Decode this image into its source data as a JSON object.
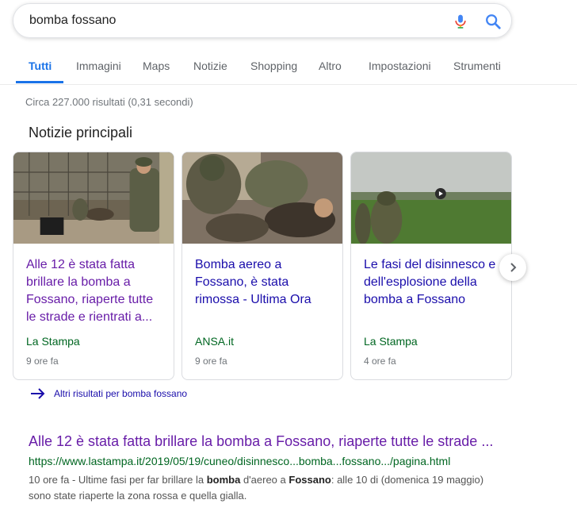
{
  "search": {
    "query": "bomba fossano"
  },
  "tabs": [
    {
      "label": "Tutti",
      "active": true
    },
    {
      "label": "Immagini"
    },
    {
      "label": "Maps"
    },
    {
      "label": "Notizie"
    },
    {
      "label": "Shopping"
    },
    {
      "label": "Altro"
    },
    {
      "label": "Impostazioni"
    },
    {
      "label": "Strumenti"
    }
  ],
  "stats": "Circa 227.000 risultati (0,31 secondi)",
  "top_stories": {
    "title": "Notizie principali",
    "cards": [
      {
        "title": "Alle 12 è stata fatta brillare la bomba a Fossano, riaperte tutte le strade e rientrati a...",
        "source": "La Stampa",
        "time": "9 ore fa"
      },
      {
        "title": "Bomba aereo a Fossano, è stata rimossa - Ultima Ora",
        "source": "ANSA.it",
        "time": "9 ore fa"
      },
      {
        "title": "Le fasi del disinnesco e dell'esplosione della bomba a Fossano",
        "source": "La Stampa",
        "time": "4 ore fa"
      }
    ],
    "more_label": "Altri risultati per bomba fossano"
  },
  "result": {
    "title": "Alle 12 è stata fatta brillare la bomba a Fossano, riaperte tutte le strade ...",
    "url": "https://www.lastampa.it/2019/05/19/cuneo/disinnesco...bomba...fossano.../pagina.html",
    "snippet": {
      "date": "10 ore fa",
      "p1": " - Ultime fasi per far brillare la ",
      "b1": "bomba",
      "p2": " d'aereo a ",
      "b2": "Fossano",
      "p3": ": alle 10 di (domenica 19 maggio) sono state riaperte la zona rossa e quella gialla."
    }
  },
  "colors": {
    "link": "#1a0dab",
    "visited": "#681da8",
    "url_green": "#006621",
    "accent": "#1a73e8"
  }
}
